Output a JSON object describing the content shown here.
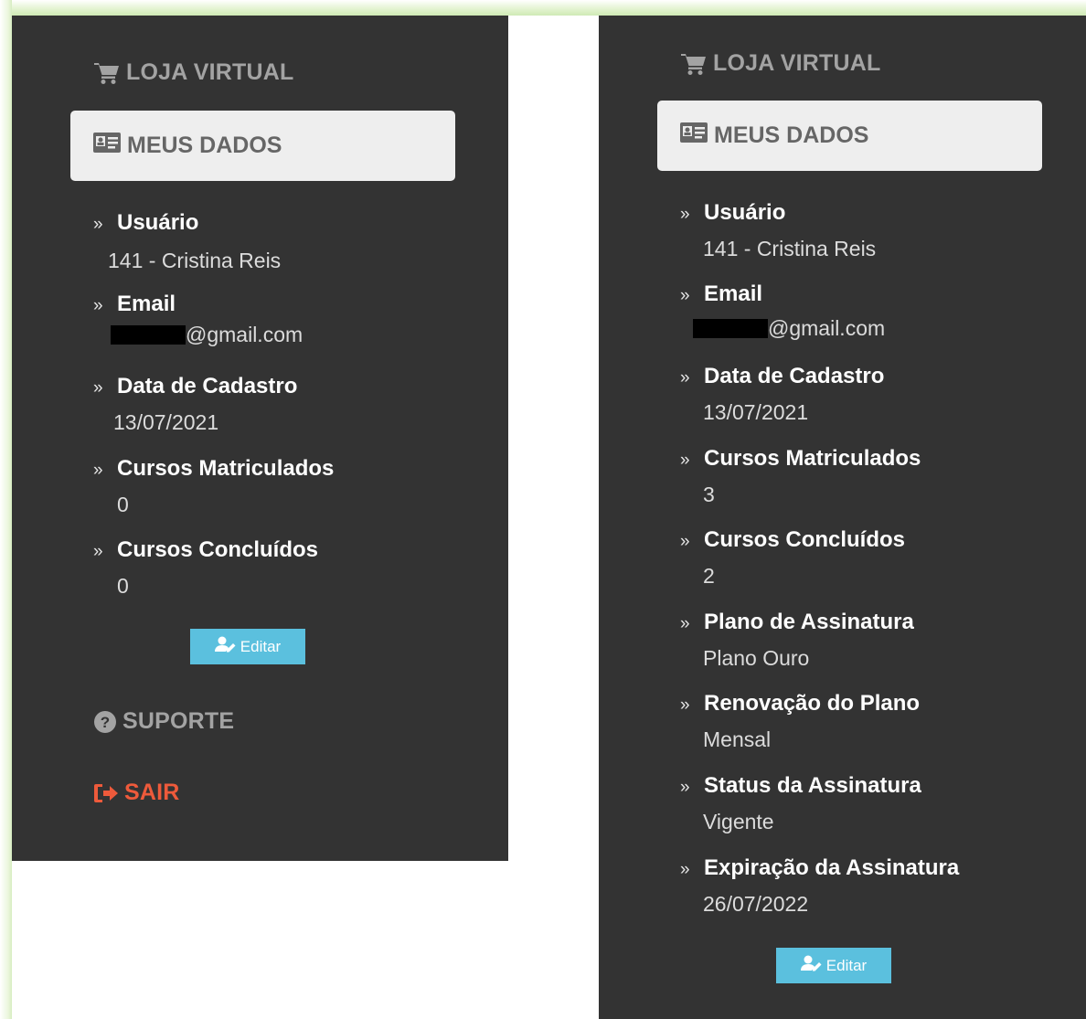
{
  "panels": [
    {
      "store_label": "LOJA VIRTUAL",
      "my_data_label": "MEUS DADOS",
      "fields": [
        {
          "label": "Usuário",
          "value": "141 - Cristina Reis"
        },
        {
          "label": "Email",
          "value": "@gmail.com"
        },
        {
          "label": "Data de Cadastro",
          "value": "13/07/2021"
        },
        {
          "label": "Cursos Matriculados",
          "value": "0"
        },
        {
          "label": "Cursos Concluídos",
          "value": "0"
        }
      ],
      "edit_label": "Editar",
      "support_label": "SUPORTE",
      "exit_label": "SAIR"
    },
    {
      "store_label": "LOJA VIRTUAL",
      "my_data_label": "MEUS DADOS",
      "fields": [
        {
          "label": "Usuário",
          "value": "141 - Cristina Reis"
        },
        {
          "label": "Email",
          "value": "@gmail.com"
        },
        {
          "label": "Data de Cadastro",
          "value": "13/07/2021"
        },
        {
          "label": "Cursos Matriculados",
          "value": "3"
        },
        {
          "label": "Cursos Concluídos",
          "value": "2"
        },
        {
          "label": "Plano de Assinatura",
          "value": "Plano Ouro"
        },
        {
          "label": "Renovação do Plano",
          "value": "Mensal"
        },
        {
          "label": "Status da Assinatura",
          "value": "Vigente"
        },
        {
          "label": "Expiração da Assinatura",
          "value": "26/07/2022"
        }
      ],
      "edit_label": "Editar"
    }
  ],
  "chevron": "»",
  "colors": {
    "panel_bg": "#333333",
    "active_bg": "#eeeeee",
    "edit_button": "#5bc0de",
    "exit_accent": "#ee5a3b",
    "nav_text": "#a3a3a3"
  },
  "icons": {
    "store": "cart-icon",
    "my_data": "id-card-icon",
    "edit": "user-edit-icon",
    "support": "question-circle-icon",
    "exit": "sign-out-icon"
  }
}
